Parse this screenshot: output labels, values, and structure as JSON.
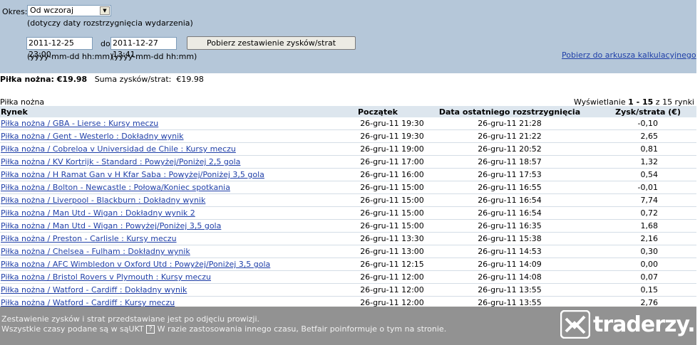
{
  "filter": {
    "period_label": "Okres:",
    "period_value": "Od wczoraj",
    "period_note": "(dotyczy daty rozstrzygnięcia wydarzenia)",
    "date_from": "2011-12-25 23:00",
    "to_label": "do",
    "date_to": "2011-12-27 13:41",
    "format_hint_from": "(yyyy-mm-dd hh:mm)",
    "format_hint_to": "(yyyy-mm-dd hh:mm)",
    "fetch_button": "Pobierz zestawienie zysków/strat",
    "spreadsheet_link": "Pobierz do arkusza kalkulacyjnego",
    "help_mark": "?"
  },
  "summary": {
    "sport_total": "Piłka nożna: €19.98",
    "sum_label": "Suma zysków/strat:",
    "sum_value": "€19.98"
  },
  "section_title": "Piłka nożna",
  "paging": {
    "prefix": "Wyświetlanie",
    "range": "1 - 15",
    "suffix": "z 15 rynki"
  },
  "table": {
    "headers": [
      "Rynek",
      "Początek",
      "Data ostatniego rozstrzygnięcia",
      "Zysk/strata (€)"
    ],
    "rows": [
      {
        "market": "Piłka nożna / GBA - Lierse : Kursy meczu",
        "start": "26-gru-11 19:30",
        "settled": "26-gru-11 21:28",
        "pl": "-0,10"
      },
      {
        "market": "Piłka nożna / Gent - Westerlo : Dokładny wynik",
        "start": "26-gru-11 19:30",
        "settled": "26-gru-11 21:22",
        "pl": "2,65"
      },
      {
        "market": "Piłka nożna / Cobreloa v Universidad de Chile : Kursy meczu",
        "start": "26-gru-11 19:00",
        "settled": "26-gru-11 20:52",
        "pl": "0,81"
      },
      {
        "market": "Piłka nożna / KV Kortrijk - Standard : Powyżej/Poniżej 2,5 gola",
        "start": "26-gru-11 17:00",
        "settled": "26-gru-11 18:57",
        "pl": "1,32"
      },
      {
        "market": "Piłka nożna / H Ramat Gan v H Kfar Saba : Powyżej/Poniżej 3,5 gola",
        "start": "26-gru-11 16:00",
        "settled": "26-gru-11 17:53",
        "pl": "0,54"
      },
      {
        "market": "Piłka nożna / Bolton - Newcastle : Połowa/Koniec spotkania",
        "start": "26-gru-11 15:00",
        "settled": "26-gru-11 16:55",
        "pl": "-0,01"
      },
      {
        "market": "Piłka nożna / Liverpool - Blackburn : Dokładny wynik",
        "start": "26-gru-11 15:00",
        "settled": "26-gru-11 16:54",
        "pl": "7,74"
      },
      {
        "market": "Piłka nożna / Man Utd - Wigan : Dokładny wynik 2",
        "start": "26-gru-11 15:00",
        "settled": "26-gru-11 16:54",
        "pl": "0,72"
      },
      {
        "market": "Piłka nożna / Man Utd - Wigan : Powyżej/Poniżej 3,5 gola",
        "start": "26-gru-11 15:00",
        "settled": "26-gru-11 16:35",
        "pl": "1,68"
      },
      {
        "market": "Piłka nożna / Preston - Carlisle : Kursy meczu",
        "start": "26-gru-11 13:30",
        "settled": "26-gru-11 15:38",
        "pl": "2,16"
      },
      {
        "market": "Piłka nożna / Chelsea - Fulham : Dokładny wynik",
        "start": "26-gru-11 13:00",
        "settled": "26-gru-11 14:53",
        "pl": "0,30"
      },
      {
        "market": "Piłka nożna / AFC Wimbledon v Oxford Utd : Powyżej/Poniżej 3,5 gola",
        "start": "26-gru-11 12:15",
        "settled": "26-gru-11 14:09",
        "pl": "0,00"
      },
      {
        "market": "Piłka nożna / Bristol Rovers v Plymouth : Kursy meczu",
        "start": "26-gru-11 12:00",
        "settled": "26-gru-11 14:08",
        "pl": "0,07"
      },
      {
        "market": "Piłka nożna / Watford - Cardiff : Dokładny wynik",
        "start": "26-gru-11 12:00",
        "settled": "26-gru-11 13:55",
        "pl": "0,15"
      },
      {
        "market": "Piłka nożna / Watford - Cardiff : Kursy meczu",
        "start": "26-gru-11 12:00",
        "settled": "26-gru-11 13:55",
        "pl": "2,76"
      }
    ]
  },
  "footer": {
    "line1": "Zestawienie zysków i strat przedstawiane jest po odjęciu prowizji.",
    "line2_before": "Wszystkie czasy podane są w sąUKT",
    "line2_mark": "?",
    "line2_after": "W razie zastosowania innego czasu, Betfair poinformuje o tym na stronie."
  },
  "watermark": {
    "text": "traderzy.pl",
    "logo_icon": "traderzy-logo-icon"
  }
}
